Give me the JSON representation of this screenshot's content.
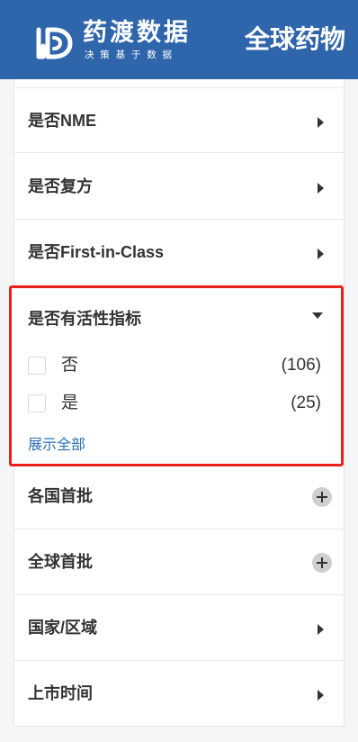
{
  "header": {
    "logo_name": "药渡数据",
    "logo_slogan": "决策基于数据",
    "page_title": "全球药物"
  },
  "filters": {
    "nme": {
      "label": "是否NME"
    },
    "combo": {
      "label": "是否复方"
    },
    "first_in_class": {
      "label": "是否First-in-Class"
    },
    "activity_index": {
      "label": "是否有活性指标",
      "options": [
        {
          "label": "否",
          "count": "(106)"
        },
        {
          "label": "是",
          "count": "(25)"
        }
      ],
      "show_all": "展示全部"
    },
    "country_approval": {
      "label": "各国首批"
    },
    "global_approval": {
      "label": "全球首批"
    },
    "region": {
      "label": "国家/区域"
    },
    "launch_time": {
      "label": "上市时间"
    }
  },
  "colors": {
    "header_bg": "#2f66ab",
    "highlight_border": "#e8221b",
    "link": "#2a72b5"
  }
}
